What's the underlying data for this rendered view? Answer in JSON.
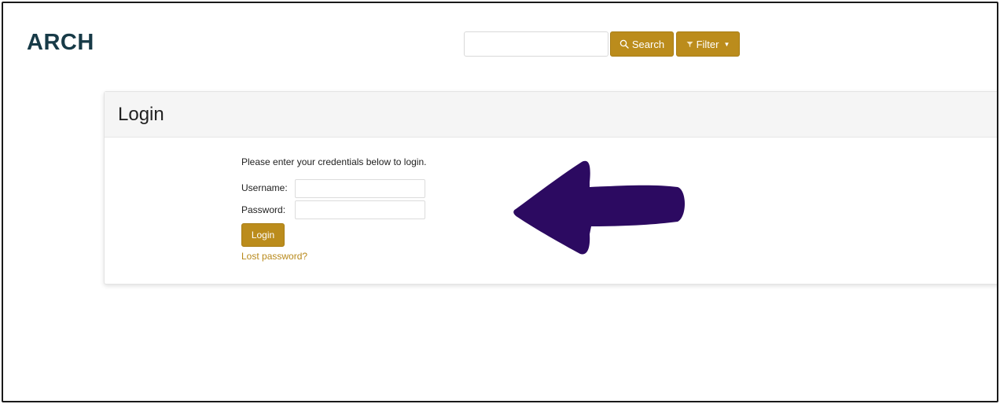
{
  "app": {
    "logo": "ARCH"
  },
  "header": {
    "search": {
      "value": "",
      "placeholder": "",
      "button_label": "Search",
      "button_icon": "search-icon"
    },
    "filter": {
      "button_label": "Filter",
      "button_icon": "filter-icon",
      "caret_icon": "caret-down-icon"
    }
  },
  "login_panel": {
    "title": "Login",
    "instructions": "Please enter your credentials below to login.",
    "username_label": "Username:",
    "username_value": "",
    "password_label": "Password:",
    "password_value": "",
    "submit_label": "Login",
    "lost_password_link": "Lost password?"
  },
  "annotation": {
    "icon": "arrow-left-icon",
    "color": "#2c0a61"
  },
  "colors": {
    "brand_text": "#173a47",
    "accent": "#bb8c1c",
    "link": "#b8891a",
    "panel_header_bg": "#f5f5f5"
  }
}
